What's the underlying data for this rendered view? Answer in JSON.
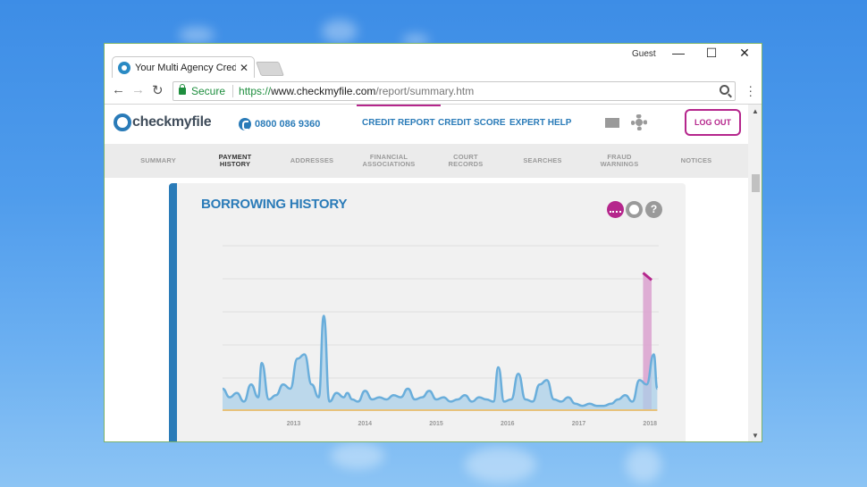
{
  "browser": {
    "tab_title": "Your Multi Agency Credit",
    "profile_label": "Guest",
    "secure_label": "Secure",
    "url_scheme": "https://",
    "url_host": "www.checkmyfile.com",
    "url_path": "/report/summary.htm"
  },
  "site": {
    "logo_text": "checkmyfile",
    "phone": "0800 086 9360",
    "top_nav": [
      {
        "label": "CREDIT REPORT",
        "active": true
      },
      {
        "label": "CREDIT SCORE",
        "active": false
      },
      {
        "label": "EXPERT HELP",
        "active": false
      }
    ],
    "logout_label": "LOG OUT",
    "sub_nav": [
      {
        "label": "SUMMARY",
        "current": false
      },
      {
        "label": "PAYMENT HISTORY",
        "line1": "PAYMENT",
        "line2": "HISTORY",
        "current": true
      },
      {
        "label": "ADDRESSES",
        "current": false
      },
      {
        "label": "FINANCIAL ASSOCIATIONS",
        "line1": "FINANCIAL",
        "line2": "ASSOCIATIONS",
        "current": false
      },
      {
        "label": "COURT RECORDS",
        "line1": "COURT",
        "line2": "RECORDS",
        "current": false
      },
      {
        "label": "SEARCHES",
        "current": false
      },
      {
        "label": "FRAUD WARNINGS",
        "line1": "FRAUD",
        "line2": "WARNINGS",
        "current": false
      },
      {
        "label": "NOTICES",
        "current": false
      }
    ]
  },
  "card": {
    "title": "BORROWING HISTORY",
    "help_glyph": "?"
  },
  "colors": {
    "brand_blue": "#2a7bb8",
    "brand_magenta": "#b5268c",
    "series_fill": "#a9cfe8",
    "series_line": "#6aaedb",
    "highlight_fill": "#dca5d0",
    "baseline": "#e8c27a"
  },
  "chart_data": {
    "type": "area",
    "x_tick_labels": [
      "2013",
      "2014",
      "2015",
      "2016",
      "2017",
      "2018"
    ],
    "x": [
      2012.0,
      2012.1,
      2012.2,
      2012.3,
      2012.4,
      2012.5,
      2012.55,
      2012.65,
      2012.75,
      2012.85,
      2012.95,
      2013.05,
      2013.15,
      2013.25,
      2013.35,
      2013.42,
      2013.5,
      2013.6,
      2013.7,
      2013.75,
      2013.82,
      2013.9,
      2014.0,
      2014.1,
      2014.2,
      2014.3,
      2014.4,
      2014.5,
      2014.6,
      2014.7,
      2014.8,
      2014.9,
      2015.0,
      2015.1,
      2015.2,
      2015.3,
      2015.4,
      2015.5,
      2015.6,
      2015.7,
      2015.8,
      2015.87,
      2015.95,
      2016.05,
      2016.15,
      2016.25,
      2016.35,
      2016.45,
      2016.55,
      2016.65,
      2016.75,
      2016.85,
      2016.95,
      2017.05,
      2017.15,
      2017.25,
      2017.35,
      2017.45,
      2017.55,
      2017.65,
      2017.75,
      2017.85,
      2017.95,
      2018.05,
      2018.1
    ],
    "values": [
      10,
      6,
      8,
      4,
      12,
      6,
      22,
      5,
      7,
      12,
      10,
      24,
      26,
      12,
      6,
      44,
      4,
      8,
      6,
      8,
      5,
      4,
      9,
      5,
      6,
      5,
      7,
      6,
      10,
      5,
      6,
      9,
      5,
      6,
      4,
      5,
      7,
      4,
      6,
      5,
      4,
      20,
      4,
      5,
      17,
      5,
      4,
      12,
      14,
      5,
      4,
      6,
      3,
      2,
      3,
      2,
      2,
      3,
      5,
      7,
      4,
      14,
      12,
      26,
      10
    ],
    "highlight_range": [
      2017.9,
      2018.02
    ],
    "highlight_level": 64,
    "ylim": [
      0,
      80
    ],
    "gridlines": true
  }
}
